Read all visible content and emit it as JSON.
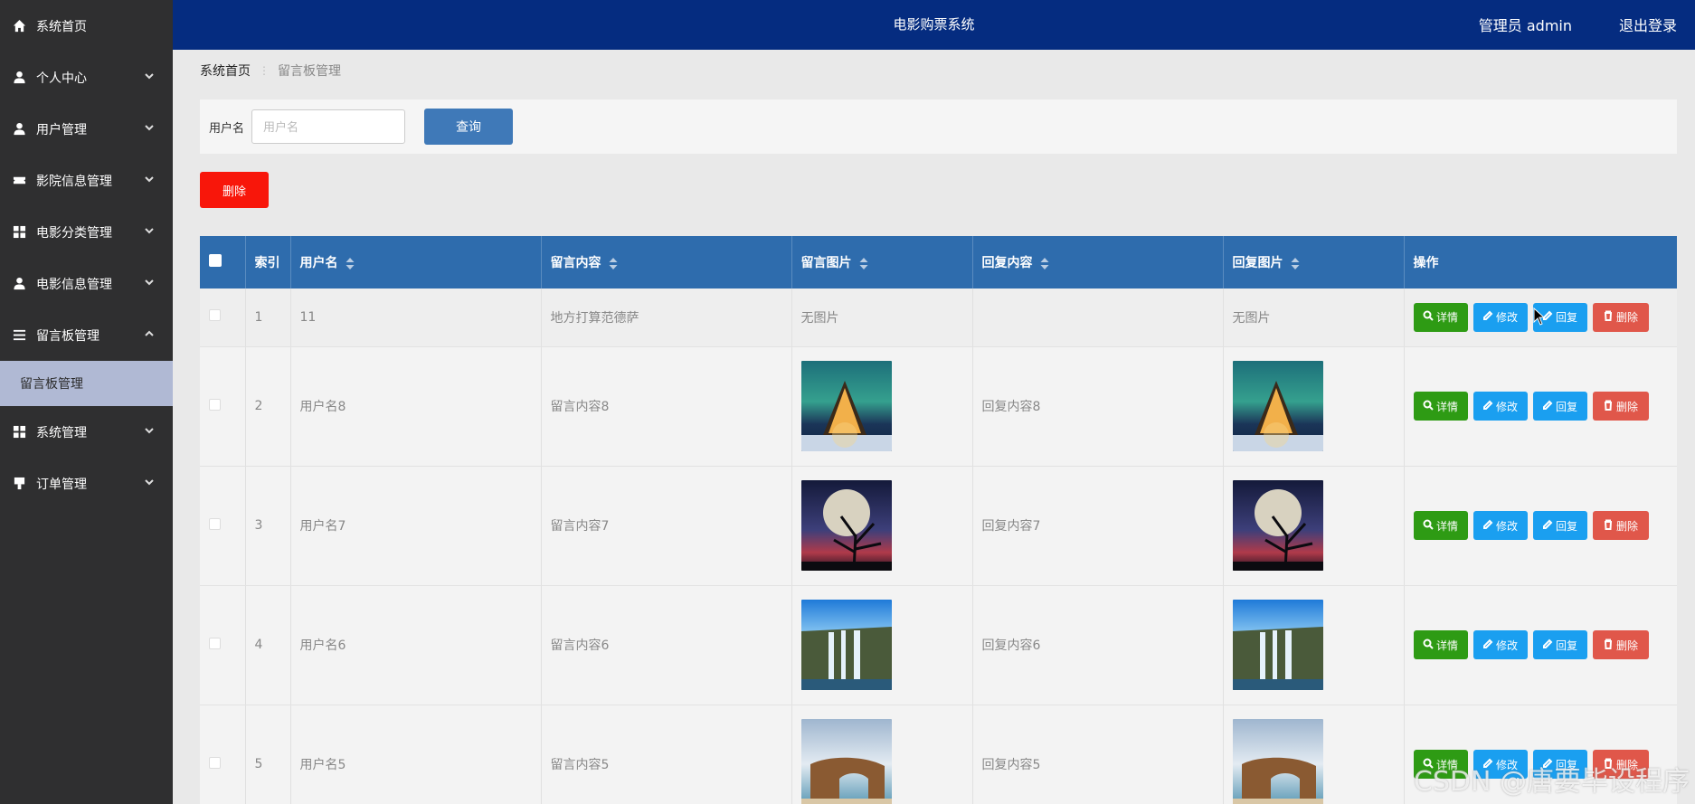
{
  "header": {
    "title": "电影购票系统",
    "user": "管理员 admin",
    "logout": "退出登录"
  },
  "sidebar": {
    "items": [
      {
        "label": "系统首页",
        "icon": "home-icon"
      },
      {
        "label": "个人中心",
        "icon": "user-icon"
      },
      {
        "label": "用户管理",
        "icon": "user-icon"
      },
      {
        "label": "影院信息管理",
        "icon": "ticket-icon"
      },
      {
        "label": "电影分类管理",
        "icon": "grid-icon"
      },
      {
        "label": "电影信息管理",
        "icon": "user-icon"
      },
      {
        "label": "留言板管理",
        "icon": "list-icon"
      },
      {
        "label": "系统管理",
        "icon": "grid-icon"
      },
      {
        "label": "订单管理",
        "icon": "stamp-icon"
      }
    ],
    "sub_item": "留言板管理"
  },
  "breadcrumb": {
    "home": "系统首页",
    "sep": "⋮",
    "current": "留言板管理"
  },
  "search": {
    "label": "用户名",
    "placeholder": "用户名",
    "button": "查询"
  },
  "actions": {
    "delete": "删除"
  },
  "table": {
    "headers": [
      "索引",
      "用户名",
      "留言内容",
      "留言图片",
      "回复内容",
      "回复图片",
      "操作"
    ],
    "no_image": "无图片",
    "op_labels": {
      "detail": "详情",
      "edit": "修改",
      "reply": "回复",
      "delete": "删除"
    },
    "rows": [
      {
        "index": "1",
        "username": "11",
        "content": "地方打算范德萨",
        "reply": ""
      },
      {
        "index": "2",
        "username": "用户名8",
        "content": "留言内容8",
        "reply": "回复内容8",
        "image": "aurora-cabin"
      },
      {
        "index": "3",
        "username": "用户名7",
        "content": "留言内容7",
        "reply": "回复内容7",
        "image": "moon-tree"
      },
      {
        "index": "4",
        "username": "用户名6",
        "content": "留言内容6",
        "reply": "回复内容6",
        "image": "waterfall"
      },
      {
        "index": "5",
        "username": "用户名5",
        "content": "留言内容5",
        "reply": "回复内容5",
        "image": "sea-arch"
      }
    ]
  },
  "watermark": "CSDN @唐要毕设程序",
  "colors": {
    "header": "#052c80",
    "sidebar": "#2f2f30",
    "table_head": "#2e6cad",
    "query": "#3f79b8",
    "delete": "#f8160a",
    "detail": "#2e9b14",
    "edit": "#1a9ff0",
    "row_delete": "#e0574a"
  }
}
